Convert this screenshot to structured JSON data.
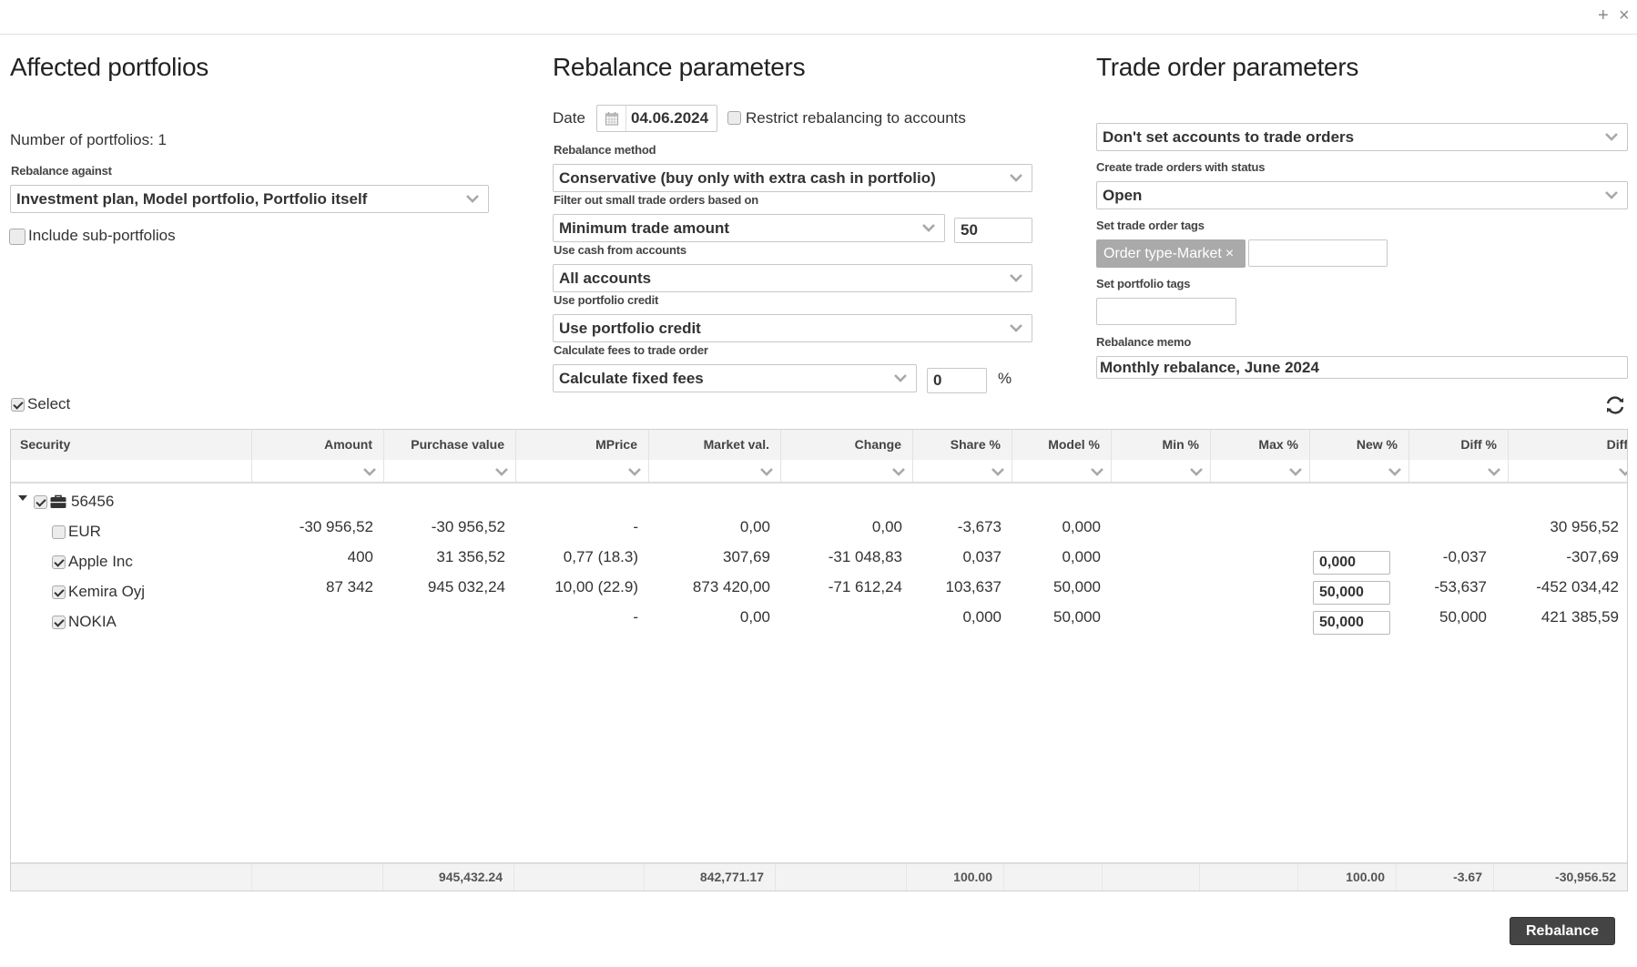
{
  "window": {
    "add_icon": "+",
    "close_icon": "×"
  },
  "affected": {
    "title": "Affected portfolios",
    "count_text": "Number of portfolios: 1",
    "rebalance_against_label": "Rebalance against",
    "rebalance_against_value": "Investment plan, Model portfolio, Portfolio itself",
    "include_sub_label": "Include sub-portfolios",
    "include_sub_checked": false
  },
  "rebalance": {
    "title": "Rebalance parameters",
    "date_label": "Date",
    "date_value": "04.06.2024",
    "restrict_label": "Restrict rebalancing to accounts",
    "restrict_checked": false,
    "method_label": "Rebalance method",
    "method_value": "Conservative (buy only with extra cash in portfolio)",
    "filter_label": "Filter out small trade orders based on",
    "filter_value": "Minimum trade amount",
    "filter_amount": "50",
    "cash_label": "Use cash from accounts",
    "cash_value": "All accounts",
    "credit_label": "Use portfolio credit",
    "credit_value": "Use portfolio credit",
    "fees_label": "Calculate fees to trade order",
    "fees_value": "Calculate fixed fees",
    "fees_amount": "0",
    "fees_unit": "%"
  },
  "trade": {
    "title": "Trade order parameters",
    "accounts_value": "Don't set accounts to trade orders",
    "status_label": "Create trade orders with status",
    "status_value": "Open",
    "tags_label": "Set trade order tags",
    "tags": [
      "Order type-Market"
    ],
    "tag_remove": "×",
    "tags_input": "",
    "portfolio_tags_label": "Set portfolio tags",
    "portfolio_tags_input": "",
    "memo_label": "Rebalance memo",
    "memo_value": "Monthly rebalance, June 2024"
  },
  "table": {
    "select_label": "Select",
    "select_checked": true,
    "columns": [
      "Security",
      "Amount",
      "Purchase value",
      "MPrice",
      "Market val.",
      "Change",
      "Share %",
      "Model %",
      "Min %",
      "Max %",
      "New %",
      "Diff %",
      "Diff"
    ],
    "group": {
      "name": "56456",
      "checked": true,
      "expanded": true
    },
    "rows": [
      {
        "name": "EUR",
        "checked": false,
        "amount": "-30 956,52",
        "purchase": "-30 956,52",
        "mprice": "-",
        "market": "0,00",
        "change": "0,00",
        "share": "-3,673",
        "model": "0,000",
        "min": "",
        "max": "",
        "new": "",
        "diffpct": "",
        "diff": "30 956,52"
      },
      {
        "name": "Apple Inc",
        "checked": true,
        "amount": "400",
        "purchase": "31 356,52",
        "mprice": "0,77 (18.3)",
        "market": "307,69",
        "change": "-31 048,83",
        "share": "0,037",
        "model": "0,000",
        "min": "",
        "max": "",
        "new": "0,000",
        "diffpct": "-0,037",
        "diff": "-307,69"
      },
      {
        "name": "Kemira Oyj",
        "checked": true,
        "amount": "87 342",
        "purchase": "945 032,24",
        "mprice": "10,00 (22.9)",
        "market": "873 420,00",
        "change": "-71 612,24",
        "share": "103,637",
        "model": "50,000",
        "min": "",
        "max": "",
        "new": "50,000",
        "diffpct": "-53,637",
        "diff": "-452 034,42"
      },
      {
        "name": "NOKIA",
        "checked": true,
        "amount": "",
        "purchase": "",
        "mprice": "-",
        "market": "0,00",
        "change": "",
        "share": "0,000",
        "model": "50,000",
        "min": "",
        "max": "",
        "new": "50,000",
        "diffpct": "50,000",
        "diff": "421 385,59"
      }
    ],
    "footer": [
      "",
      "",
      "945,432.24",
      "",
      "842,771.17",
      "",
      "100.00",
      "",
      "",
      "",
      "100.00",
      "-3.67",
      "-30,956.52"
    ]
  },
  "actions": {
    "rebalance_label": "Rebalance"
  }
}
